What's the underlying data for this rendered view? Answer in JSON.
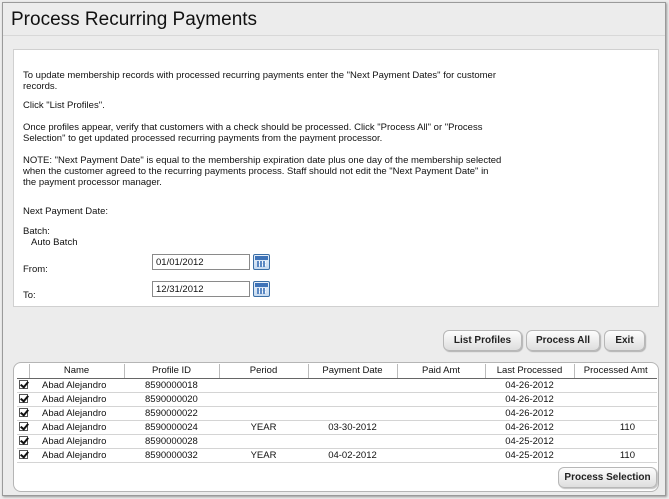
{
  "page": {
    "title": "Process Recurring Payments"
  },
  "instructions": {
    "p1": "To update membership records with processed recurring payments enter the \"Next Payment Dates\" for customer records.",
    "p2": "Click \"List Profiles\".",
    "p3": "Once profiles appear, verify that customers with a check should be processed. Click \"Process All\" or \"Process Selection\" to get updated processed recurring payments from the payment processor.",
    "p4": "NOTE: \"Next Payment Date\" is equal to the membership expiration date plus one day of the membership selected when the customer agreed to the recurring payments process. Staff should not edit the \"Next Payment Date\" in the payment processor manager."
  },
  "form": {
    "next_payment_label": "Next Payment Date:",
    "batch_label": "Batch:",
    "batch_value": "Auto Batch",
    "from_label": "From:",
    "from_value": "01/01/2012",
    "to_label": "To:",
    "to_value": "12/31/2012"
  },
  "actions": {
    "list_profiles": "List Profiles",
    "process_all": "Process All",
    "exit": "Exit",
    "process_selection": "Process Selection"
  },
  "table": {
    "columns": [
      "Name",
      "Profile ID",
      "Period",
      "Payment Date",
      "Paid Amt",
      "Last Processed",
      "Processed Amt"
    ],
    "rows": [
      {
        "checked": true,
        "name": "Abad Alejandro",
        "profile_id": "8590000018",
        "period": "",
        "payment_date": "",
        "paid_amt": "",
        "last_processed": "04-26-2012",
        "processed_amt": ""
      },
      {
        "checked": true,
        "name": "Abad Alejandro",
        "profile_id": "8590000020",
        "period": "",
        "payment_date": "",
        "paid_amt": "",
        "last_processed": "04-26-2012",
        "processed_amt": ""
      },
      {
        "checked": true,
        "name": "Abad Alejandro",
        "profile_id": "8590000022",
        "period": "",
        "payment_date": "",
        "paid_amt": "",
        "last_processed": "04-26-2012",
        "processed_amt": ""
      },
      {
        "checked": true,
        "name": "Abad Alejandro",
        "profile_id": "8590000024",
        "period": "YEAR",
        "payment_date": "03-30-2012",
        "paid_amt": "",
        "last_processed": "04-26-2012",
        "processed_amt": "110"
      },
      {
        "checked": true,
        "name": "Abad Alejandro",
        "profile_id": "8590000028",
        "period": "",
        "payment_date": "",
        "paid_amt": "",
        "last_processed": "04-25-2012",
        "processed_amt": ""
      },
      {
        "checked": true,
        "name": "Abad Alejandro",
        "profile_id": "8590000032",
        "period": "YEAR",
        "payment_date": "04-02-2012",
        "paid_amt": "",
        "last_processed": "04-25-2012",
        "processed_amt": "110"
      }
    ]
  },
  "icons": {
    "calendar": "calendar-icon",
    "check": "checkbox-checked-icon"
  }
}
